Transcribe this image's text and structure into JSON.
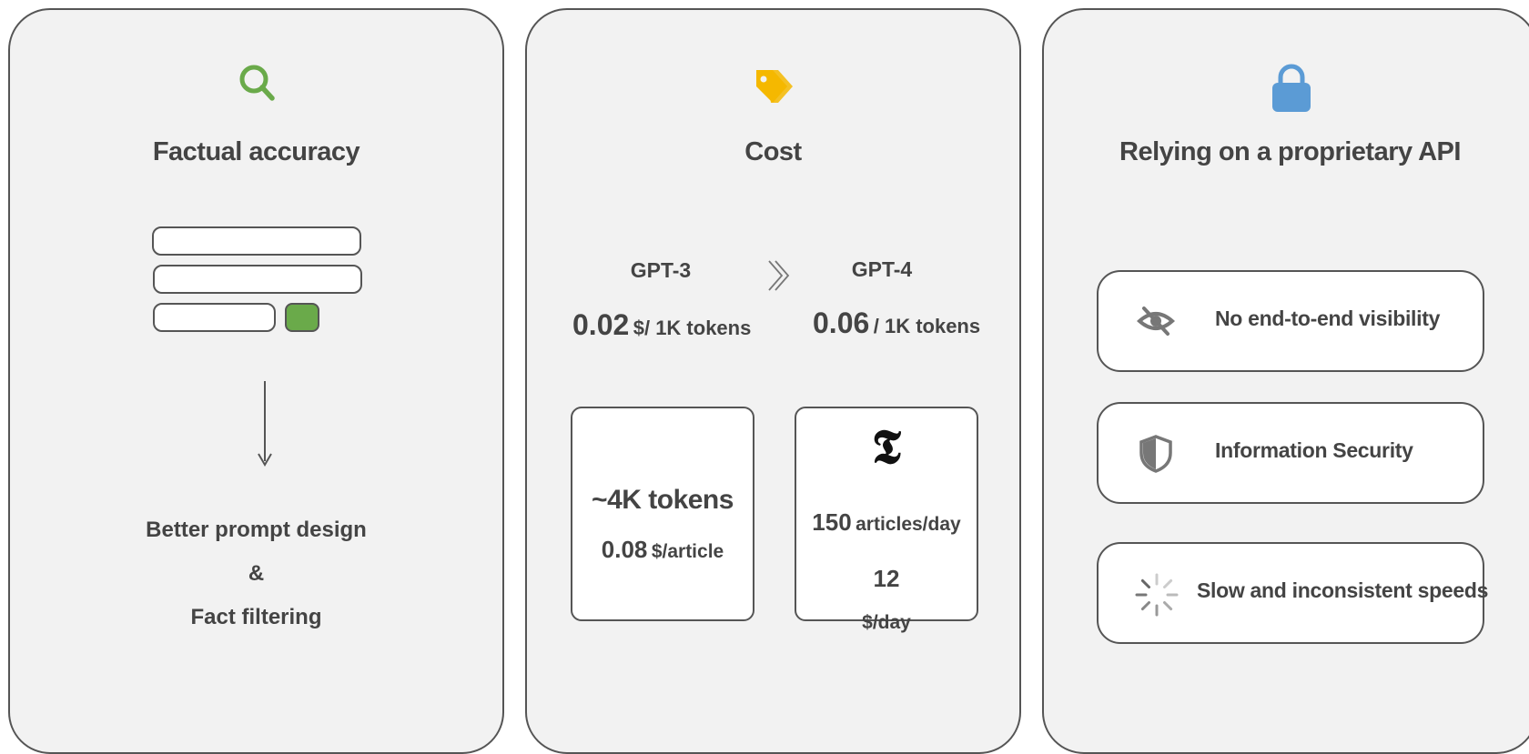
{
  "panels": {
    "accuracy": {
      "icon": "search-icon",
      "title": "Factual accuracy",
      "solution_line1": "Better prompt design",
      "solution_line2": "&",
      "solution_line3": "Fact filtering"
    },
    "cost": {
      "icon": "price-tag-icon",
      "title": "Cost",
      "model_a": {
        "name": "GPT-3",
        "price": "0.02",
        "unit": "$/ 1K tokens"
      },
      "model_b": {
        "name": "GPT-4",
        "price": "0.06",
        "unit": "/ 1K tokens"
      },
      "per_article": {
        "tokens": "~4K tokens",
        "price": "0.08",
        "unit": "$/article"
      },
      "per_day": {
        "logo": "𝕿",
        "articles": "150",
        "articles_unit": "articles/day",
        "price": "12",
        "price_unit": "$/day"
      }
    },
    "api": {
      "icon": "lock-icon",
      "title": "Relying on a proprietary API",
      "risks": [
        {
          "icon": "eye-slash-icon",
          "label": "No end-to-end visibility"
        },
        {
          "icon": "shield-icon",
          "label": "Information Security"
        },
        {
          "icon": "spinner-icon",
          "label": "Slow and inconsistent speeds"
        }
      ]
    }
  },
  "colors": {
    "search": "#6aaa4a",
    "tag": "#f5b800",
    "lock": "#5b9bd5",
    "button": "#6aaa4a",
    "panel_bg": "#f2f2f2",
    "stroke": "#555555"
  }
}
